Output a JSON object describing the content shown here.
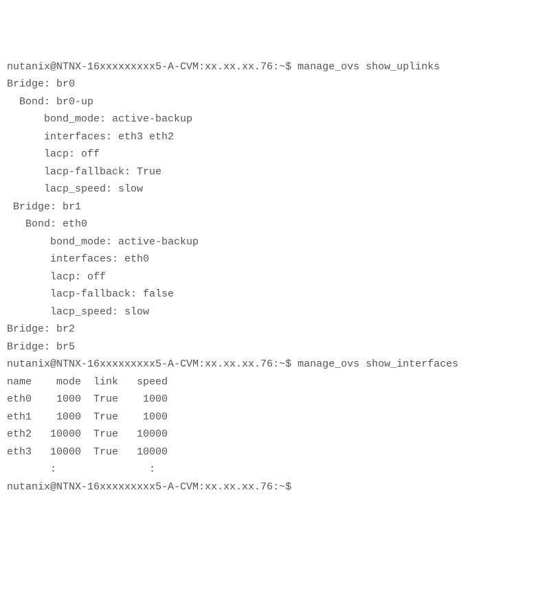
{
  "prompt1": "nutanix@NTNX-16xxxxxxxxx5-A-CVM:xx.xx.xx.76:~$ manage_ovs show_uplinks",
  "uplinks": {
    "bridges": [
      {
        "name": "br0",
        "bonds": [
          {
            "name": "br0-up",
            "bond_mode": "active-backup",
            "interfaces": "eth3 eth2",
            "lacp": "off",
            "lacp_fallback": "True",
            "lacp_speed": "slow"
          }
        ]
      },
      {
        "name": "br1",
        "bonds": [
          {
            "name": "eth0",
            "bond_mode": "active-backup",
            "interfaces": "eth0",
            "lacp": "off",
            "lacp_fallback": "false",
            "lacp_speed": "slow"
          }
        ]
      },
      {
        "name": "br2",
        "bonds": []
      },
      {
        "name": "br5",
        "bonds": []
      }
    ]
  },
  "prompt2": "nutanix@NTNX-16xxxxxxxxx5-A-CVM:xx.xx.xx.76:~$ manage_ovs show_interfaces",
  "interfaces": {
    "header": "name    mode  link   speed",
    "rows": [
      {
        "name": "eth0",
        "mode": "1000",
        "link": "True",
        "speed": "1000"
      },
      {
        "name": "eth1",
        "mode": "1000",
        "link": "True",
        "speed": "1000"
      },
      {
        "name": "eth2",
        "mode": "10000",
        "link": "True",
        "speed": "10000"
      },
      {
        "name": "eth3",
        "mode": "10000",
        "link": "True",
        "speed": "10000"
      }
    ],
    "trailing": "       :               :"
  },
  "prompt3": "nutanix@NTNX-16xxxxxxxxx5-A-CVM:xx.xx.xx.76:~$"
}
